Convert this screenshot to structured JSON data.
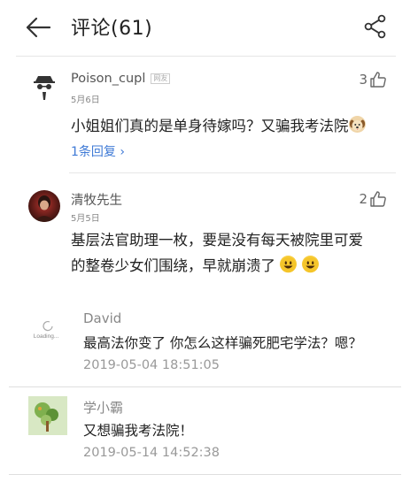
{
  "header": {
    "title": "评论(61)",
    "back_icon": "back-arrow-icon",
    "share_icon": "share-icon"
  },
  "comments": [
    {
      "user": "Poison_cupl",
      "badge": "网友",
      "date": "5月6日",
      "likes": "3",
      "text": "小姐姐们真的是单身待嫁吗？又骗我考法院",
      "text_emoji": "dog-emoji",
      "reply_link": "1条回复 ›"
    },
    {
      "user": "清牧先生",
      "date": "5月5日",
      "likes": "2",
      "text_line1": "基层法官助理一枚，要是没有每天被院里可爱",
      "text_line2": "的整卷少女们围绕，早就崩溃了",
      "text_emoji": "smile-emoji"
    }
  ],
  "replies": [
    {
      "user": "David",
      "avatar_text": "Loading...",
      "text": "最高法你变了 你怎么这样骗死肥宅学法？嗯？",
      "time": "2019-05-04 18:51:05"
    },
    {
      "user": "学小霸",
      "text": "又想骗我考法院！",
      "time": "2019-05-14 14:52:38"
    }
  ],
  "colors": {
    "link": "#3f7ad6",
    "divider": "#e6e6e6"
  }
}
